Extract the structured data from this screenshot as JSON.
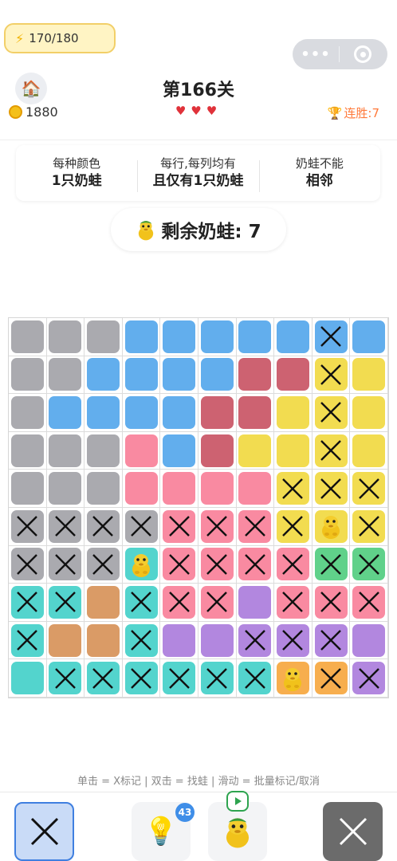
{
  "status": {
    "energy": "170/180",
    "coins": "1880",
    "level_title": "第166关",
    "hearts": "♥♥♥",
    "streak": "连胜:7"
  },
  "rules": [
    {
      "line1": "每种颜色",
      "line2": "1只奶蛙"
    },
    {
      "line1": "每行,每列均有",
      "line2": "且仅有1只奶蛙"
    },
    {
      "line1": "奶蛙不能",
      "line2": "相邻"
    }
  ],
  "remaining": "剩余奶蛙: 7",
  "palette": {
    "G": "#aaaaaf",
    "B": "#62aeed",
    "R": "#cd6271",
    "Y": "#f2dc50",
    "P": "#f98aa1",
    "N": "#60d18a",
    "T": "#53d4cd",
    "O": "#da9b66",
    "V": "#b287df",
    "A": "#f7ae4e"
  },
  "board": {
    "rows": [
      [
        "G",
        "G",
        "G",
        "B",
        "B",
        "B",
        "B",
        "B",
        "B",
        "B"
      ],
      [
        "G",
        "G",
        "B",
        "B",
        "B",
        "B",
        "R",
        "R",
        "Y",
        "Y"
      ],
      [
        "G",
        "B",
        "B",
        "B",
        "B",
        "R",
        "R",
        "Y",
        "Y",
        "Y"
      ],
      [
        "G",
        "G",
        "G",
        "P",
        "B",
        "R",
        "Y",
        "Y",
        "Y",
        "Y"
      ],
      [
        "G",
        "G",
        "G",
        "P",
        "P",
        "P",
        "P",
        "Y",
        "Y",
        "Y"
      ],
      [
        "G",
        "G",
        "G",
        "G",
        "P",
        "P",
        "P",
        "Y",
        "Y",
        "Y"
      ],
      [
        "G",
        "G",
        "G",
        "T",
        "P",
        "P",
        "P",
        "P",
        "N",
        "N"
      ],
      [
        "T",
        "T",
        "O",
        "T",
        "P",
        "P",
        "V",
        "P",
        "P",
        "P"
      ],
      [
        "T",
        "O",
        "O",
        "T",
        "V",
        "V",
        "V",
        "V",
        "V",
        "V"
      ],
      [
        "T",
        "T",
        "T",
        "T",
        "T",
        "T",
        "T",
        "A",
        "A",
        "V"
      ]
    ],
    "marks": [
      "........X.",
      "........X.",
      "........X.",
      "........X.",
      ".......XXX",
      "XXXXXXXXFX",
      "XXXFXXXXXX",
      "XX.XXX.XXX",
      "X..X..XXX.",
      ".XXXXXXFXX"
    ]
  },
  "hint_text": "单击 = X标记 | 双击 = 找蛙 | 滑动 = 批量标记/取消",
  "toolbar": {
    "hint_count": "43"
  },
  "icons": {
    "energy": "lightning-icon",
    "home": "house-icon",
    "coin": "coin-icon",
    "trophy": "trophy-icon",
    "frog": "frog-icon",
    "hint": "lightbulb-icon",
    "video": "video-ad-icon",
    "x_mode": "x-mark-icon",
    "clear": "clear-icon"
  }
}
